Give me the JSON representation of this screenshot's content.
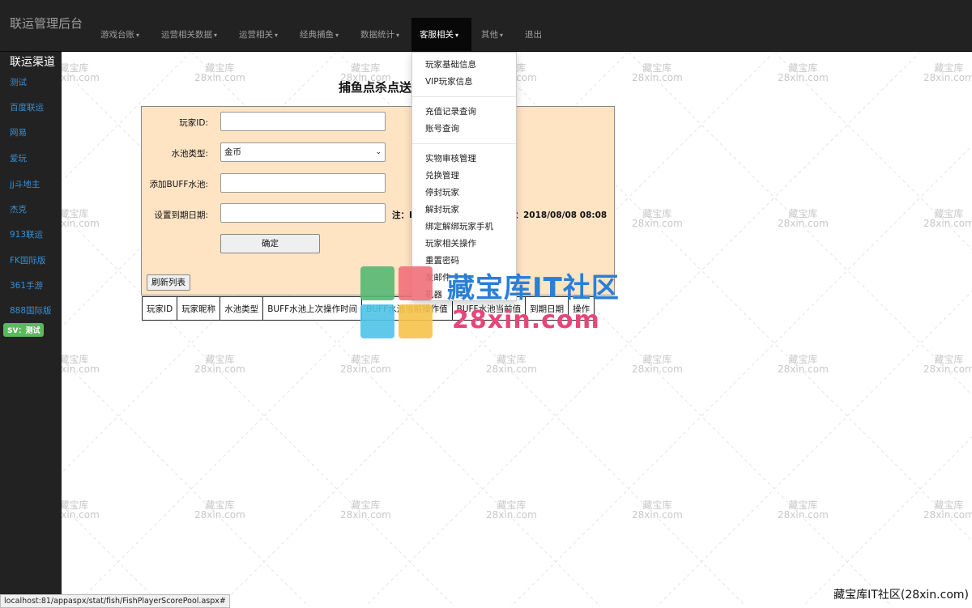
{
  "navbar": {
    "brand": "联运管理后台",
    "items": [
      {
        "label": "游戏台账",
        "caret": "▾"
      },
      {
        "label": "运营相关数据",
        "caret": "▾"
      },
      {
        "label": "运营相关",
        "caret": "▾"
      },
      {
        "label": "经典捕鱼",
        "caret": "▾"
      },
      {
        "label": "数据统计",
        "caret": "▾"
      },
      {
        "label": "客服相关",
        "caret": "▾"
      },
      {
        "label": "其他",
        "caret": "▾"
      },
      {
        "label": "退出",
        "caret": ""
      }
    ],
    "active_item": "客服相关"
  },
  "sidebar": {
    "title": "联运渠道",
    "links": [
      "测试",
      "百度联运",
      "网易",
      "爱玩",
      "jj斗地主",
      "杰克",
      "913联运",
      "FK国际版",
      "361手游",
      "888国际版"
    ],
    "badge": "SV：测试"
  },
  "page": {
    "title": "捕鱼点杀点送",
    "form": {
      "player_id_label": "玩家ID:",
      "player_id_value": "",
      "pool_type_label": "水池类型:",
      "pool_type_value": "金币",
      "buff_pool_label": "添加BUFF水池:",
      "buff_pool_value": "",
      "expire_label": "设置到期日期:",
      "expire_value": "",
      "note_prefix": "注：I",
      "note_suffix": "式：2018/08/08 08:08",
      "confirm_label": "确定",
      "refresh_label": "刷新列表"
    },
    "table_headers": [
      "玩家ID",
      "玩家昵称",
      "水池类型",
      "BUFF水池上次操作时间",
      "BUFF水池当前操作值",
      "BUFF水池当前值",
      "到期日期",
      "操作"
    ]
  },
  "dropdown": {
    "group1": [
      "玩家基础信息",
      "VIP玩家信息"
    ],
    "group2": [
      "充值记录查询",
      "账号查询"
    ],
    "group3": [
      "实物审核管理",
      "兑换管理",
      "停封玩家",
      "解封玩家",
      "绑定解绑玩家手机",
      "玩家相关操作",
      "重置密码",
      "发邮件",
      "机器"
    ]
  },
  "watermark": {
    "cn": "藏宝库IT社区",
    "en": "28xin.com",
    "small_cn": "藏宝库",
    "small_en": "28xin.com",
    "corner": "藏宝库IT社区(28xin.com)",
    "colors": [
      "#55b873",
      "#f0707a",
      "#4fc3e8",
      "#f6c34a"
    ]
  },
  "status_bar": {
    "url": "localhost:81/appaspx/stat/fish/FishPlayerScorePool.aspx#"
  }
}
